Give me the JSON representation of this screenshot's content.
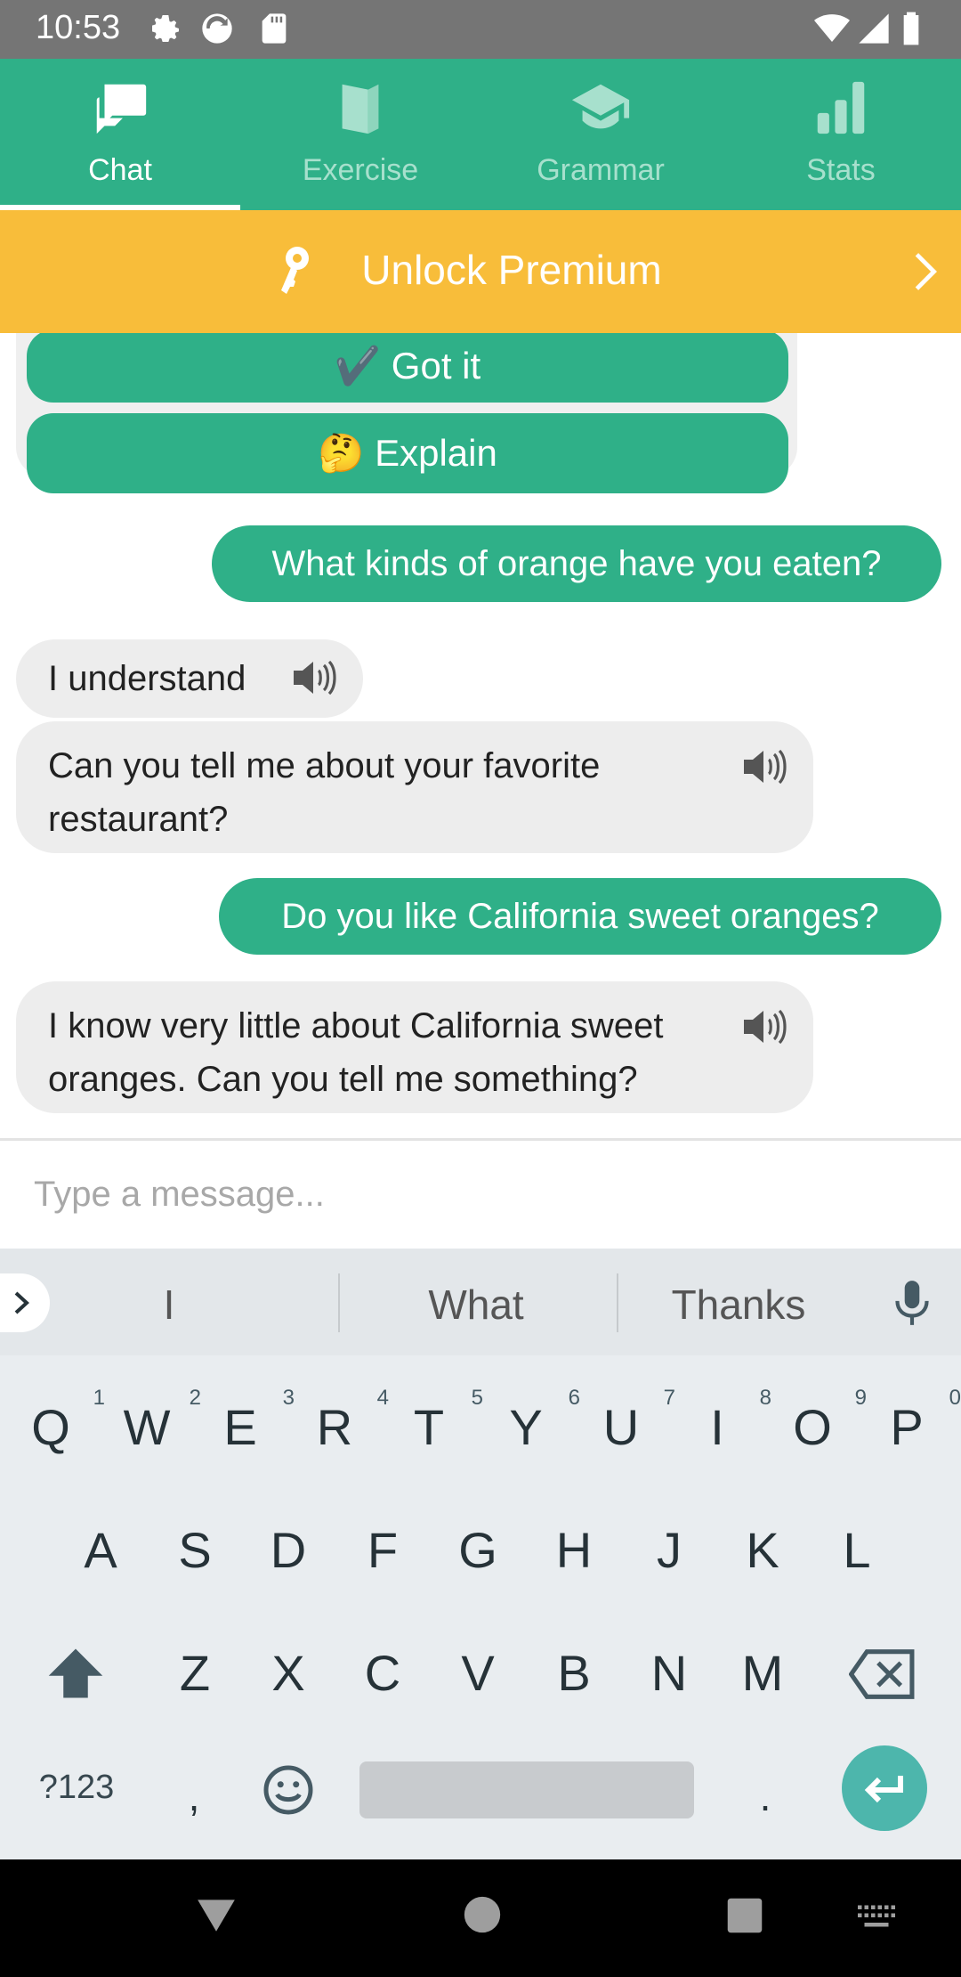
{
  "status_bar": {
    "time": "10:53"
  },
  "tabs": [
    {
      "label": "Chat",
      "icon": "chat-icon",
      "active": true
    },
    {
      "label": "Exercise",
      "icon": "book-icon",
      "active": false
    },
    {
      "label": "Grammar",
      "icon": "graduation-cap-icon",
      "active": false
    },
    {
      "label": "Stats",
      "icon": "bar-chart-icon",
      "active": false
    }
  ],
  "premium": {
    "label": "Unlock Premium"
  },
  "quiz_card": {
    "got_it": "✔️ Got it",
    "explain": "🤔 Explain"
  },
  "messages": [
    {
      "from": "me",
      "text": "What kinds of orange have you eaten?"
    },
    {
      "from": "bot",
      "text": "I understand"
    },
    {
      "from": "bot",
      "text": "Can you tell me about your favorite restaurant?"
    },
    {
      "from": "me",
      "text": "Do you like California sweet oranges?"
    },
    {
      "from": "bot",
      "text": "I know very little about California sweet oranges. Can you tell me something?"
    }
  ],
  "input": {
    "placeholder": "Type a message..."
  },
  "keyboard": {
    "suggestions": [
      "I",
      "What",
      "Thanks"
    ],
    "row1": [
      "Q",
      "W",
      "E",
      "R",
      "T",
      "Y",
      "U",
      "I",
      "O",
      "P"
    ],
    "row1_hints": [
      "1",
      "2",
      "3",
      "4",
      "5",
      "6",
      "7",
      "8",
      "9",
      "0"
    ],
    "row2": [
      "A",
      "S",
      "D",
      "F",
      "G",
      "H",
      "J",
      "K",
      "L"
    ],
    "row3": [
      "Z",
      "X",
      "C",
      "V",
      "B",
      "N",
      "M"
    ],
    "symbols_key": "?123",
    "comma": ",",
    "period": "."
  },
  "colors": {
    "brand": "#2fb088",
    "premium": "#f8bd3a",
    "bubble_bot": "#ededed"
  }
}
